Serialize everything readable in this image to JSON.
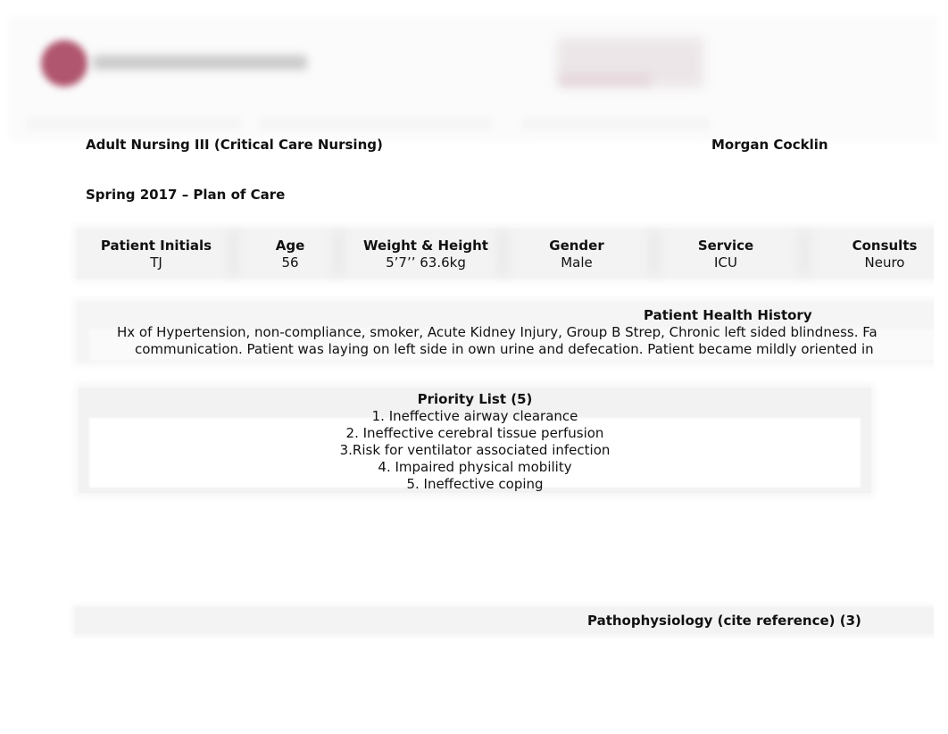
{
  "header": {
    "logo_icon": "university-logo-circle",
    "logo_text": "[blurred institution name]",
    "right_block": "[blurred header text]",
    "colors": {
      "logo": "#b0566e"
    }
  },
  "document": {
    "course_title": "Adult Nursing III (Critical Care Nursing)",
    "student_name": "Morgan Cocklin",
    "term_title": "Spring 2017 – Plan of Care"
  },
  "patient_info": {
    "columns": [
      {
        "label": "Patient Initials",
        "value": "TJ"
      },
      {
        "label": "Age",
        "value": "56"
      },
      {
        "label": "Weight & Height",
        "value": "5’7’’ 63.6kg"
      },
      {
        "label": "Gender",
        "value": "Male"
      },
      {
        "label": "Service",
        "value": "ICU"
      },
      {
        "label": "Consults",
        "value": "Neuro"
      }
    ]
  },
  "health_history": {
    "title": "Patient Health History",
    "lines": [
      "Hx of Hypertension, non-compliance, smoker, Acute Kidney Injury, Group B Strep, Chronic left sided blindness. Fa",
      "communication. Patient was laying on left side in own urine and defecation. Patient became mildly oriented in"
    ]
  },
  "priority_list": {
    "title": "Priority List (5)",
    "items": [
      "1. Ineffective airway clearance",
      "2. Ineffective cerebral tissue perfusion",
      "3.Risk for ventilator associated infection",
      "4. Impaired physical mobility",
      "5. Ineffective coping"
    ]
  },
  "pathophysiology": {
    "title": "Pathophysiology (cite reference) (3)"
  }
}
